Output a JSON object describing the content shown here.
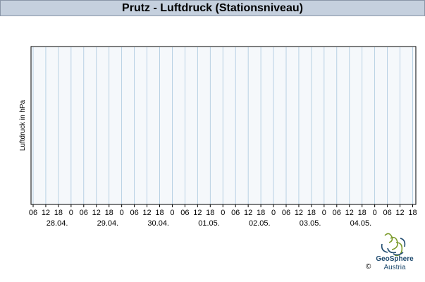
{
  "chart_data": {
    "type": "line",
    "title": "Prutz - Luftdruck (Stationsniveau)",
    "ylabel": "Luftdruck in hPa",
    "x_tick_labels": [
      "06",
      "12",
      "18",
      "0",
      "06",
      "12",
      "18",
      "0",
      "06",
      "12",
      "18",
      "0",
      "06",
      "12",
      "18",
      "0",
      "06",
      "12",
      "18",
      "0",
      "06",
      "12",
      "18",
      "0",
      "06",
      "12",
      "18",
      "0",
      "06",
      "12",
      "18"
    ],
    "date_labels": [
      "28.04.",
      "29.04.",
      "30.04.",
      "01.05.",
      "02.05.",
      "03.05.",
      "04.05."
    ],
    "series": [],
    "grid": true,
    "colors": {
      "plot_bg": "#f5f8fb",
      "grid": "#a9c7de",
      "axis": "#000000",
      "title_bg": "#c5d0de"
    }
  },
  "logo": {
    "name": "GeoSphere",
    "sub": "Austria",
    "copyright": "©"
  }
}
